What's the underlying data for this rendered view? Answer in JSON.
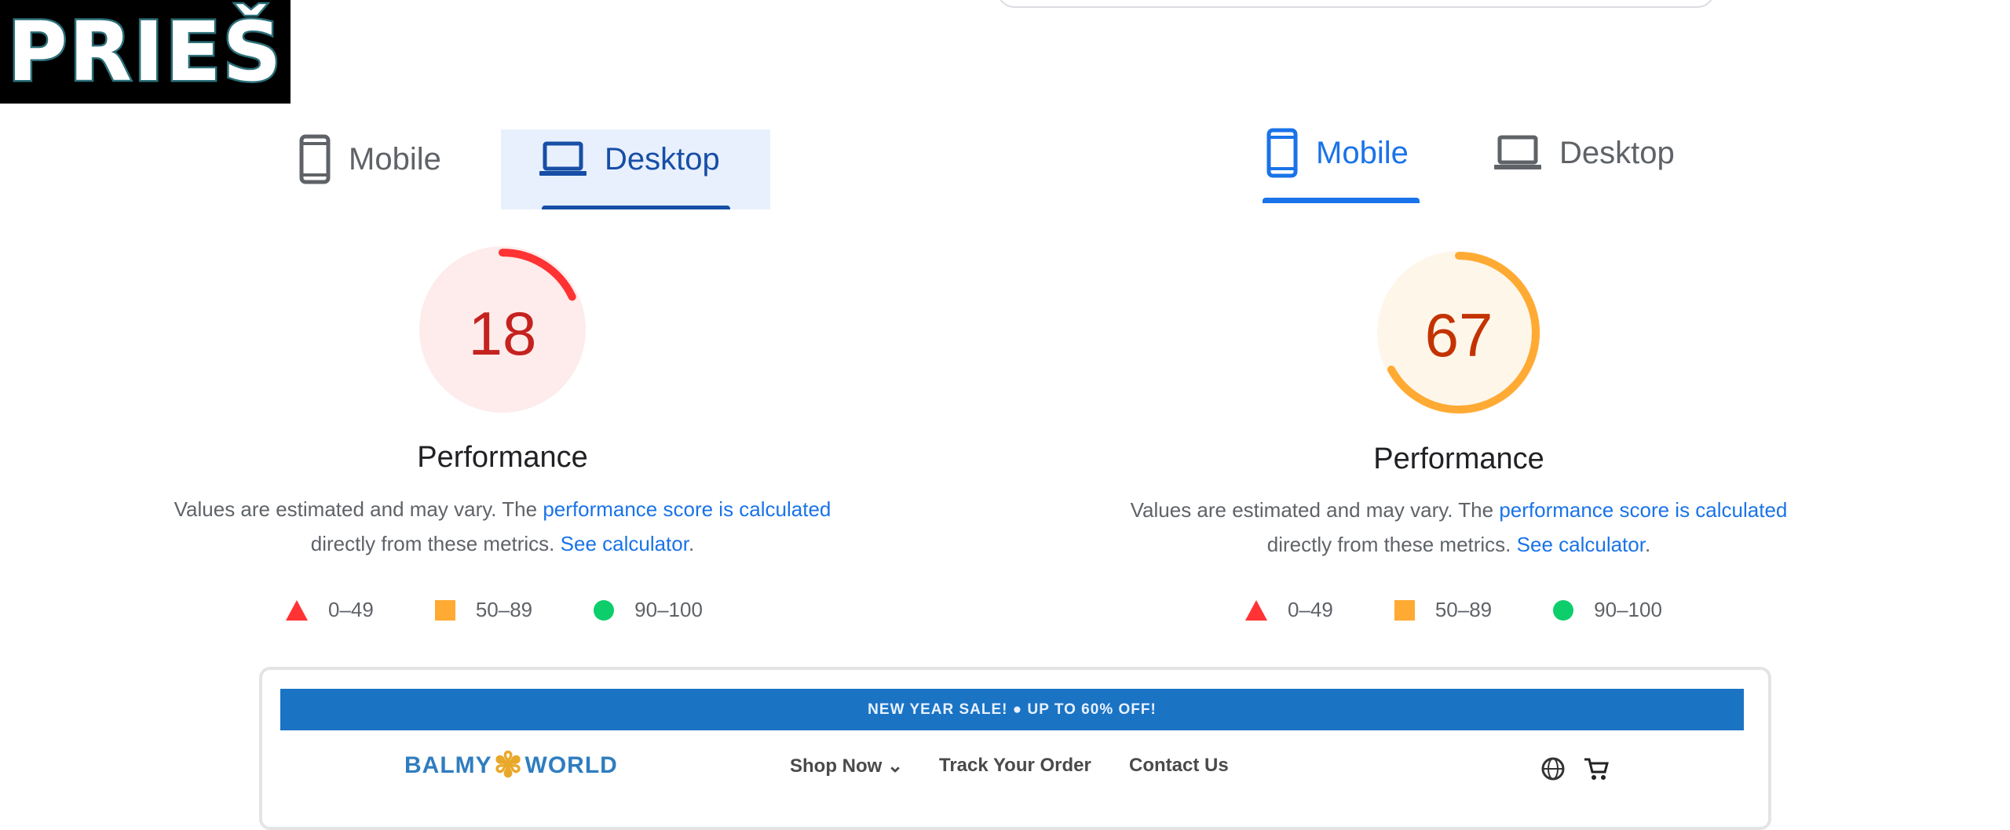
{
  "overlay": {
    "label": "PRIEŠ"
  },
  "left_panel": {
    "tabs": [
      {
        "label": "Mobile",
        "icon": "phone-icon",
        "active": false
      },
      {
        "label": "Desktop",
        "icon": "laptop-icon",
        "active": true
      }
    ],
    "score": {
      "value": "18",
      "fraction": 0.18,
      "category": "fail"
    },
    "title": "Performance",
    "desc": {
      "text_before": "Values are estimated and may vary. The ",
      "link1": "performance score is calculated",
      "text_middle": "directly from these metrics. ",
      "link2": "See calculator",
      "text_after": "."
    },
    "legend": [
      "0–49",
      "50–89",
      "90–100"
    ]
  },
  "right_panel": {
    "tabs": [
      {
        "label": "Mobile",
        "icon": "phone-icon",
        "active": true
      },
      {
        "label": "Desktop",
        "icon": "laptop-icon",
        "active": false
      }
    ],
    "score": {
      "value": "67",
      "fraction": 0.67,
      "category": "average"
    },
    "title": "Performance",
    "desc": {
      "text_before": "Values are estimated and may vary. The ",
      "link1": "performance score is calculated",
      "text_middle": "directly from these metrics. ",
      "link2": "See calculator",
      "text_after": "."
    },
    "legend": [
      "0–49",
      "50–89",
      "90–100"
    ]
  },
  "preview": {
    "banner": "NEW YEAR SALE! ● UP TO 60% OFF!",
    "logo_left": "BALMY",
    "logo_right": "WORLD",
    "nav": [
      "Shop Now ⌄",
      "Track Your Order",
      "Contact Us"
    ]
  },
  "colors": {
    "fail": "#ff3333",
    "fail_bg": "#fdeceb",
    "fail_text": "#c5221f",
    "average": "#ffaa33",
    "average_bg": "#fff6ea",
    "average_text": "#c33300",
    "pass": "#0cce6b",
    "link": "#1a73e8"
  }
}
